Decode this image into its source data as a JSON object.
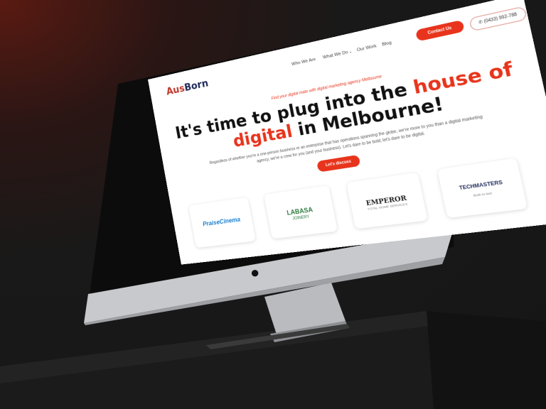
{
  "site": {
    "logo_first": "Aus",
    "logo_second": "Born",
    "nav": [
      "Who We Are",
      "What We Do",
      "Our Work",
      "Blog"
    ],
    "nav_dropdown_icon": "chevron-down-icon",
    "contact_button": "Contact Us",
    "phone": "(0433) 992-788",
    "phone_icon": "phone-icon",
    "tagline": "Find your digital mate with digital marketing agency Melbourne",
    "headline": {
      "line1": "It's time to plug into the",
      "highlight1": "house of",
      "highlight2": "digital",
      "line2_rest": "in Melbourne!"
    },
    "paragraph": "Regardless of whether you're a one-person business or an enterprise that has operations spanning the globe, we're more to you than a digital marketing agency, we're a crew for you (and your business). Let's dare to be bold; let's dare to be digital.",
    "cta": "Let's discuss",
    "client_logos": [
      {
        "name": "PraiseCinema",
        "sub": ""
      },
      {
        "name": "LABASA",
        "sub": "JOINERY"
      },
      {
        "name": "EMPEROR",
        "sub": "TOTAL HOME SERVICES"
      },
      {
        "name": "TECHMASTERS",
        "sub": "Built to last"
      }
    ]
  },
  "device": {
    "logo_icon": "apple-logo-icon"
  },
  "colors": {
    "accent": "#e8341c",
    "navy": "#1e2a5a",
    "background": "#161616"
  }
}
